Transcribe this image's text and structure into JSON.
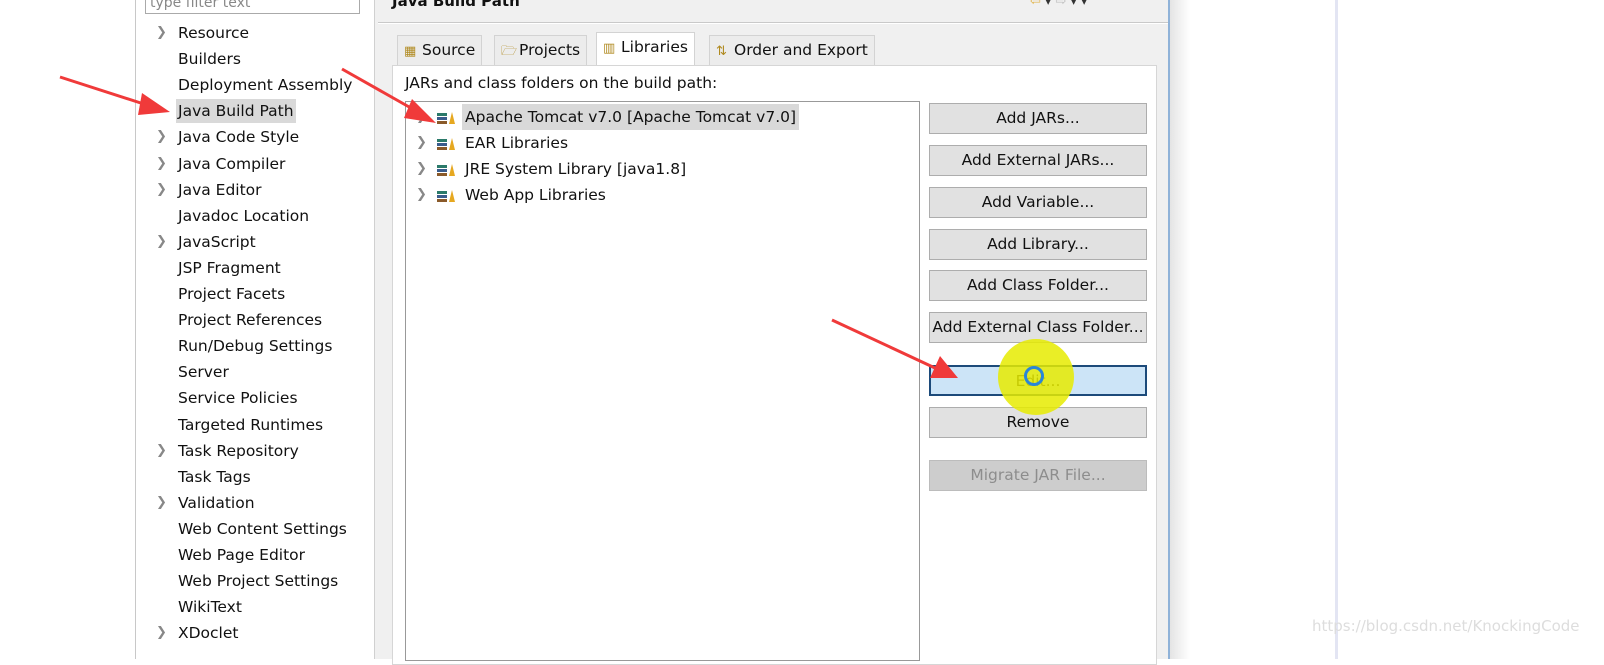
{
  "filter": {
    "placeholder": "type filter text"
  },
  "tree": [
    {
      "label": "Resource",
      "expandable": true
    },
    {
      "label": "Builders",
      "expandable": false
    },
    {
      "label": "Deployment Assembly",
      "expandable": false
    },
    {
      "label": "Java Build Path",
      "expandable": false,
      "selected": true
    },
    {
      "label": "Java Code Style",
      "expandable": true
    },
    {
      "label": "Java Compiler",
      "expandable": true
    },
    {
      "label": "Java Editor",
      "expandable": true
    },
    {
      "label": "Javadoc Location",
      "expandable": false
    },
    {
      "label": "JavaScript",
      "expandable": true
    },
    {
      "label": "JSP Fragment",
      "expandable": false
    },
    {
      "label": "Project Facets",
      "expandable": false
    },
    {
      "label": "Project References",
      "expandable": false
    },
    {
      "label": "Run/Debug Settings",
      "expandable": false
    },
    {
      "label": "Server",
      "expandable": false
    },
    {
      "label": "Service Policies",
      "expandable": false
    },
    {
      "label": "Targeted Runtimes",
      "expandable": false
    },
    {
      "label": "Task Repository",
      "expandable": true
    },
    {
      "label": "Task Tags",
      "expandable": false
    },
    {
      "label": "Validation",
      "expandable": true
    },
    {
      "label": "Web Content Settings",
      "expandable": false
    },
    {
      "label": "Web Page Editor",
      "expandable": false
    },
    {
      "label": "Web Project Settings",
      "expandable": false
    },
    {
      "label": "WikiText",
      "expandable": false
    },
    {
      "label": "XDoclet",
      "expandable": true
    }
  ],
  "page": {
    "title": "Java Build Path"
  },
  "tabs": [
    {
      "label": "Source",
      "icon": "source-folder-icon"
    },
    {
      "label": "Projects",
      "icon": "folder-icon"
    },
    {
      "label": "Libraries",
      "icon": "library-icon",
      "active": true
    },
    {
      "label": "Order and Export",
      "icon": "order-icon"
    }
  ],
  "panel": {
    "label": "JARs and class folders on the build path:"
  },
  "libraries": [
    {
      "label": "Apache Tomcat v7.0 [Apache Tomcat v7.0]",
      "selected": true
    },
    {
      "label": "EAR Libraries"
    },
    {
      "label": "JRE System Library [java1.8]"
    },
    {
      "label": "Web App Libraries"
    }
  ],
  "buttons": [
    {
      "label": "Add JARs..."
    },
    {
      "label": "Add External JARs..."
    },
    {
      "label": "Add Variable..."
    },
    {
      "label": "Add Library..."
    },
    {
      "label": "Add Class Folder..."
    },
    {
      "label": "Add External Class Folder..."
    },
    {
      "label": "Edit...",
      "focused": true
    },
    {
      "label": "Remove"
    },
    {
      "label": "Migrate JAR File...",
      "disabled": true
    }
  ],
  "watermark": "https://blog.csdn.net/KnockingCode",
  "colors": {
    "annotation_arrow": "#f03a3a",
    "cursor_highlight": "#e6eb00",
    "selection": "#d9d9d9",
    "focus_button": "#cce4f7"
  }
}
